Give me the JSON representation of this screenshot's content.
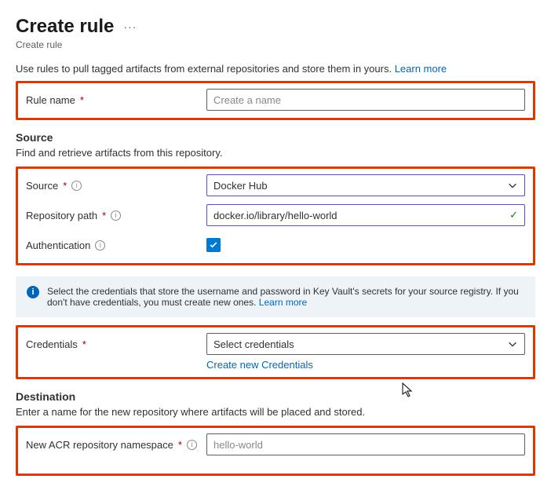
{
  "page": {
    "title": "Create rule",
    "breadcrumb": "Create rule",
    "intro": "Use rules to pull tagged artifacts from external repositories and store them in yours.",
    "learn_more": "Learn more"
  },
  "rule_name": {
    "label": "Rule name",
    "placeholder": "Create a name"
  },
  "source_section": {
    "title": "Source",
    "desc": "Find and retrieve artifacts from this repository."
  },
  "source": {
    "label": "Source",
    "value": "Docker Hub"
  },
  "repo_path": {
    "label": "Repository path",
    "value": "docker.io/library/hello-world"
  },
  "auth": {
    "label": "Authentication"
  },
  "info_banner": {
    "text": "Select the credentials that store the username and password in Key Vault's secrets for your source registry. If you don't have credentials, you must create new ones.",
    "learn_more": "Learn more"
  },
  "credentials": {
    "label": "Credentials",
    "placeholder": "Select credentials",
    "create_link": "Create new Credentials"
  },
  "destination_section": {
    "title": "Destination",
    "desc": "Enter a name for the new repository where artifacts will be placed and stored."
  },
  "namespace": {
    "label": "New ACR repository namespace",
    "value": "hello-world"
  }
}
